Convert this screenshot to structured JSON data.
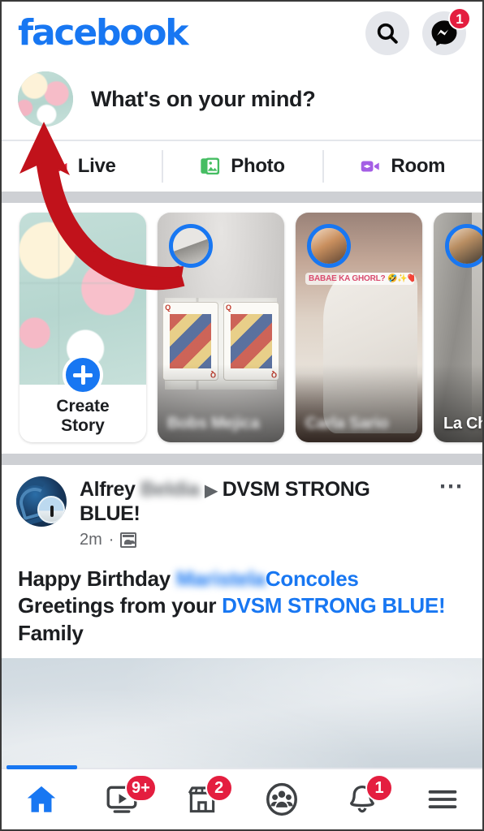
{
  "app": {
    "brand": "facebook",
    "brand_color": "#1877F2",
    "badge_color": "#E41E3F"
  },
  "topbar": {
    "search_icon": "search-icon",
    "messenger_icon": "messenger-icon",
    "messenger_badge": "1"
  },
  "composer": {
    "prompt": "What's on your mind?",
    "avatar_icon": "user-avatar-flowers"
  },
  "actions": [
    {
      "label": "Live",
      "icon": "live-video-icon",
      "color": "#E3253B"
    },
    {
      "label": "Photo",
      "icon": "photo-gallery-icon",
      "color": "#45BD62"
    },
    {
      "label": "Room",
      "icon": "video-room-icon",
      "color": "#A45EE5"
    }
  ],
  "stories": {
    "create": {
      "label_line1": "Create",
      "label_line2": "Story",
      "plus_icon": "plus-icon"
    },
    "items": [
      {
        "name": "Bobs Mejica",
        "blurred": true,
        "overlay_text": ""
      },
      {
        "name": "Carla Sario",
        "blurred": true,
        "overlay_text": "BABAE KA GHORL? 🤣✨❤️"
      },
      {
        "name": "La Chic Gordit",
        "blurred": false,
        "overlay_text": ""
      }
    ]
  },
  "post": {
    "author": "Alfrey",
    "author_blurred": "Beldia",
    "group_arrow": "▶",
    "group": "DVSM STRONG BLUE!",
    "timestamp": "2m",
    "separator": "·",
    "privacy_icon": "friends-privacy-icon",
    "menu_icon": "ellipsis-icon",
    "body": {
      "line1_pre": "Happy Birthday ",
      "line1_mention_blurred": "Maristela",
      "line1_mention": "Concoles",
      "line2_pre": "Greetings from your ",
      "line2_mention": "DVSM STRONG BLUE!",
      "line3": "Family"
    }
  },
  "bottom_nav": [
    {
      "name": "home",
      "icon": "home-icon",
      "badge": "",
      "active": true
    },
    {
      "name": "watch",
      "icon": "watch-video-icon",
      "badge": "9+",
      "active": false
    },
    {
      "name": "marketplace",
      "icon": "marketplace-store-icon",
      "badge": "2",
      "active": false
    },
    {
      "name": "groups",
      "icon": "groups-icon",
      "badge": "",
      "active": false
    },
    {
      "name": "notifications",
      "icon": "bell-icon",
      "badge": "1",
      "active": false
    },
    {
      "name": "menu",
      "icon": "hamburger-menu-icon",
      "badge": "",
      "active": false
    }
  ],
  "annotation": {
    "type": "red-curved-arrow",
    "color": "#C1121B"
  }
}
